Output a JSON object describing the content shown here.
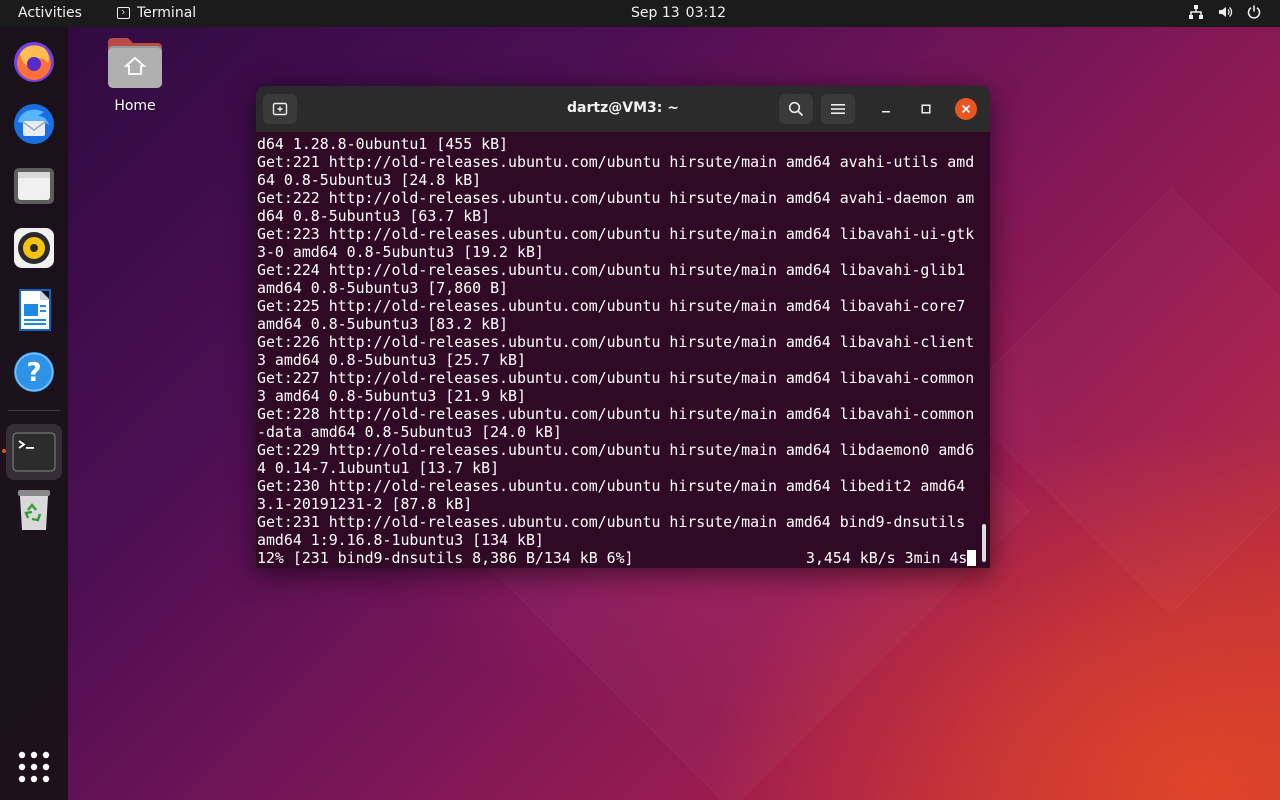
{
  "topbar": {
    "activities": "Activities",
    "app_name": "Terminal",
    "date": "Sep 13",
    "time": "03:12",
    "tray_icons": [
      "network-icon",
      "volume-icon",
      "power-icon"
    ]
  },
  "dock": {
    "items": [
      {
        "name": "Firefox",
        "icon": "firefox-icon"
      },
      {
        "name": "Thunderbird",
        "icon": "thunderbird-icon"
      },
      {
        "name": "Files",
        "icon": "files-icon"
      },
      {
        "name": "Rhythmbox",
        "icon": "rhythmbox-icon"
      },
      {
        "name": "LibreOffice Writer",
        "icon": "writer-icon"
      },
      {
        "name": "Help",
        "icon": "help-icon"
      },
      {
        "name": "Terminal",
        "icon": "terminal-icon",
        "running": true
      },
      {
        "name": "Trash",
        "icon": "trash-icon"
      }
    ],
    "app_grid_icon": "app-grid-icon"
  },
  "desktop": {
    "home_label": "Home"
  },
  "terminal": {
    "title": "dartz@VM3: ~",
    "lines": [
      "d64 1.28.8-0ubuntu1 [455 kB]",
      "Get:221 http://old-releases.ubuntu.com/ubuntu hirsute/main amd64 avahi-utils amd",
      "64 0.8-5ubuntu3 [24.8 kB]",
      "Get:222 http://old-releases.ubuntu.com/ubuntu hirsute/main amd64 avahi-daemon am",
      "d64 0.8-5ubuntu3 [63.7 kB]",
      "Get:223 http://old-releases.ubuntu.com/ubuntu hirsute/main amd64 libavahi-ui-gtk",
      "3-0 amd64 0.8-5ubuntu3 [19.2 kB]",
      "Get:224 http://old-releases.ubuntu.com/ubuntu hirsute/main amd64 libavahi-glib1",
      "amd64 0.8-5ubuntu3 [7,860 B]",
      "Get:225 http://old-releases.ubuntu.com/ubuntu hirsute/main amd64 libavahi-core7",
      "amd64 0.8-5ubuntu3 [83.2 kB]",
      "Get:226 http://old-releases.ubuntu.com/ubuntu hirsute/main amd64 libavahi-client",
      "3 amd64 0.8-5ubuntu3 [25.7 kB]",
      "Get:227 http://old-releases.ubuntu.com/ubuntu hirsute/main amd64 libavahi-common",
      "3 amd64 0.8-5ubuntu3 [21.9 kB]",
      "Get:228 http://old-releases.ubuntu.com/ubuntu hirsute/main amd64 libavahi-common",
      "-data amd64 0.8-5ubuntu3 [24.0 kB]",
      "Get:229 http://old-releases.ubuntu.com/ubuntu hirsute/main amd64 libdaemon0 amd6",
      "4 0.14-7.1ubuntu1 [13.7 kB]",
      "Get:230 http://old-releases.ubuntu.com/ubuntu hirsute/main amd64 libedit2 amd64",
      "3.1-20191231-2 [87.8 kB]",
      "Get:231 http://old-releases.ubuntu.com/ubuntu hirsute/main amd64 bind9-dnsutils",
      "amd64 1:9.16.8-1ubuntu3 [134 kB]"
    ],
    "status_left": "12% [231 bind9-dnsutils 8,386 B/134 kB 6%]",
    "status_right": "3,454 kB/s 3min 4s"
  },
  "colors": {
    "terminal_bg": "#300a24",
    "header_bg": "#2b2b2b",
    "accent": "#e95420",
    "topbar_bg": "#1b1b1b"
  }
}
